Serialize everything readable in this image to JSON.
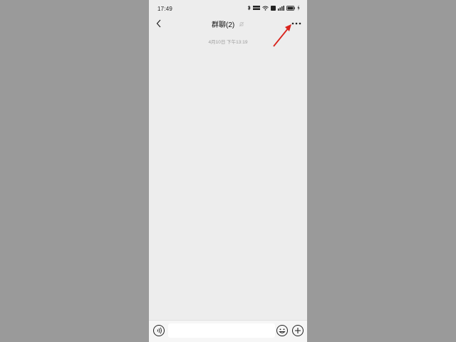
{
  "status_bar": {
    "time": "17:49",
    "battery": "100"
  },
  "header": {
    "title": "群聊(2)"
  },
  "chat": {
    "timestamp": "4月10日 下午13:19"
  },
  "input_bar": {
    "placeholder": ""
  },
  "annotation": {
    "arrow_color": "#d9231c"
  },
  "icons": {
    "back": "chevron-left-icon",
    "mute": "bell-muted-icon",
    "more": "more-dots-icon",
    "voice": "voice-icon",
    "emoji": "emoji-icon",
    "plus": "plus-icon"
  }
}
